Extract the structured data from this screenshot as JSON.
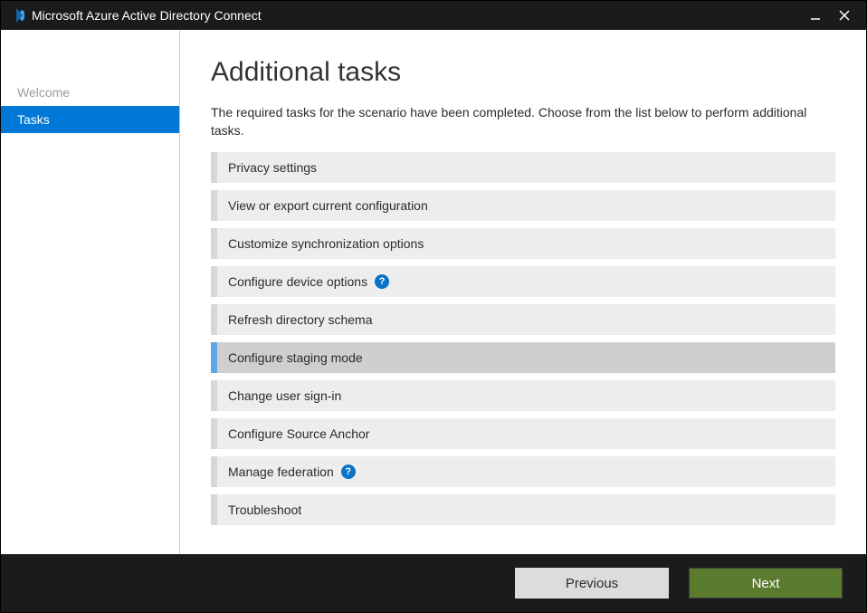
{
  "window": {
    "title": "Microsoft Azure Active Directory Connect"
  },
  "sidebar": {
    "steps": [
      {
        "label": "Welcome",
        "active": false
      },
      {
        "label": "Tasks",
        "active": true
      }
    ]
  },
  "page": {
    "heading": "Additional tasks",
    "description": "The required tasks for the scenario have been completed. Choose from the list below to perform additional tasks."
  },
  "tasks": [
    {
      "label": "Privacy settings",
      "help": false,
      "selected": false
    },
    {
      "label": "View or export current configuration",
      "help": false,
      "selected": false
    },
    {
      "label": "Customize synchronization options",
      "help": false,
      "selected": false
    },
    {
      "label": "Configure device options",
      "help": true,
      "selected": false
    },
    {
      "label": "Refresh directory schema",
      "help": false,
      "selected": false
    },
    {
      "label": "Configure staging mode",
      "help": false,
      "selected": true
    },
    {
      "label": "Change user sign-in",
      "help": false,
      "selected": false
    },
    {
      "label": "Configure Source Anchor",
      "help": false,
      "selected": false
    },
    {
      "label": "Manage federation",
      "help": true,
      "selected": false
    },
    {
      "label": "Troubleshoot",
      "help": false,
      "selected": false
    }
  ],
  "footer": {
    "previous": "Previous",
    "next": "Next"
  },
  "glyphs": {
    "help": "?"
  }
}
